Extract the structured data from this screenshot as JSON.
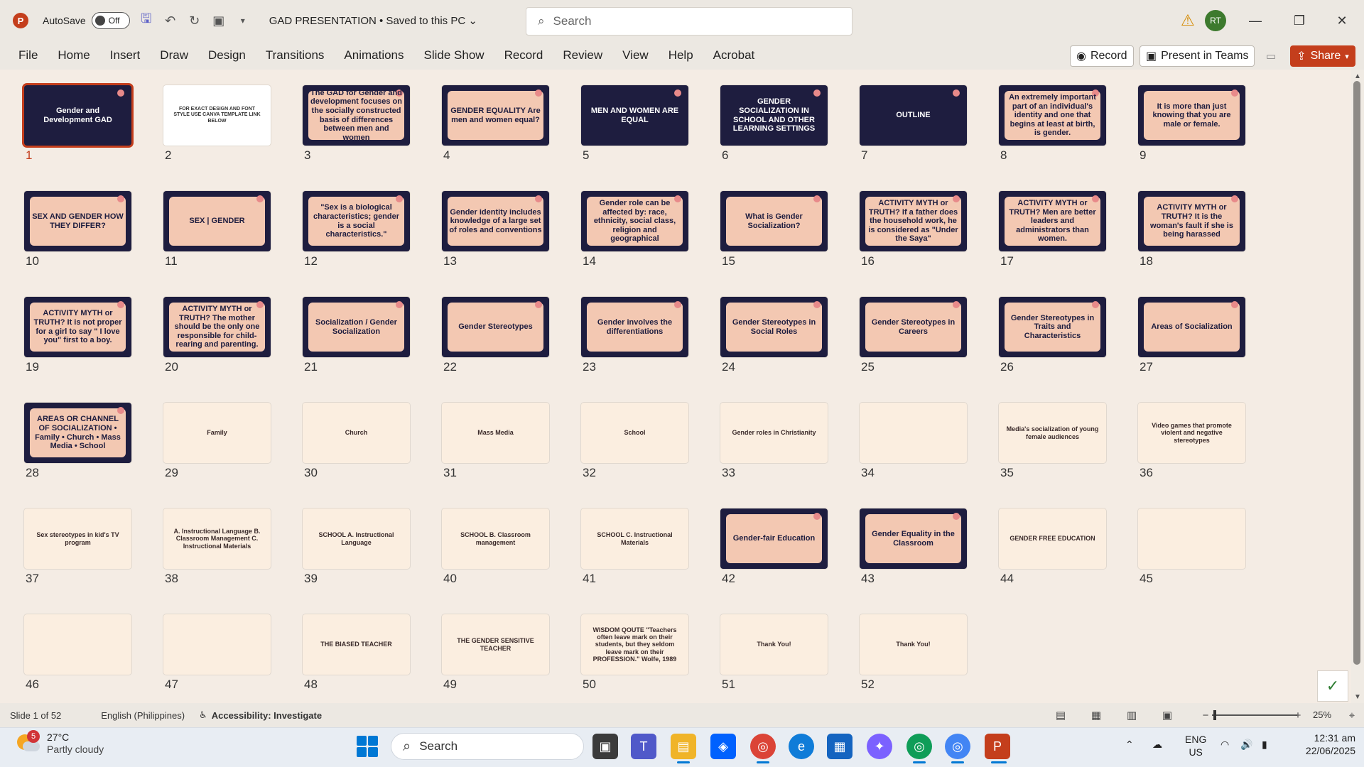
{
  "app": {
    "autosave_label": "AutoSave",
    "autosave_state": "Off",
    "doc_title": "GAD PRESENTATION • Saved to this PC",
    "search_placeholder": "Search",
    "avatar_initials": "RT",
    "accent_color": "#c43e1c"
  },
  "menu": [
    "File",
    "Home",
    "Insert",
    "Draw",
    "Design",
    "Transitions",
    "Animations",
    "Slide Show",
    "Record",
    "Review",
    "View",
    "Help",
    "Acrobat"
  ],
  "ribbon_buttons": {
    "record": "Record",
    "present": "Present in Teams",
    "share": "Share"
  },
  "slides": [
    {
      "num": "1",
      "text": "Gender and Development GAD",
      "style": "navy",
      "selected": true
    },
    {
      "num": "2",
      "text": "FOR EXACT DESIGN AND FONT STYLE USE CANVA TEMPLATE LINK BELOW",
      "style": "white"
    },
    {
      "num": "3",
      "text": "The GAD for Gender and development focuses on the socially constructed basis of differences between men and women",
      "style": "dark"
    },
    {
      "num": "4",
      "text": "GENDER EQUALITY Are men and women equal?",
      "style": "dark"
    },
    {
      "num": "5",
      "text": "MEN AND WOMEN ARE EQUAL",
      "style": "navy"
    },
    {
      "num": "6",
      "text": "GENDER SOCIALIZATION IN SCHOOL AND OTHER LEARNING SETTINGS",
      "style": "navy"
    },
    {
      "num": "7",
      "text": "OUTLINE",
      "style": "navy"
    },
    {
      "num": "8",
      "text": "An extremely important part of an individual's identity and one that begins at least at birth, is gender.",
      "style": "dark"
    },
    {
      "num": "9",
      "text": "It is more than just knowing that you are male or female.",
      "style": "dark"
    },
    {
      "num": "10",
      "text": "SEX AND GENDER HOW THEY DIFFER?",
      "style": "dark"
    },
    {
      "num": "11",
      "text": "SEX | GENDER",
      "style": "dark"
    },
    {
      "num": "12",
      "text": "\"Sex is a biological characteristics; gender is a social characteristics.\"",
      "style": "dark"
    },
    {
      "num": "13",
      "text": "Gender identity includes knowledge of a large set of roles and conventions",
      "style": "dark"
    },
    {
      "num": "14",
      "text": "Gender role can be affected by: race, ethnicity, social class, religion and geographical",
      "style": "dark"
    },
    {
      "num": "15",
      "text": "What is Gender Socialization?",
      "style": "dark"
    },
    {
      "num": "16",
      "text": "ACTIVITY MYTH or TRUTH? If a father does the household work, he is considered as \"Under the Saya\"",
      "style": "dark"
    },
    {
      "num": "17",
      "text": "ACTIVITY MYTH or TRUTH? Men are better leaders and administrators than women.",
      "style": "dark"
    },
    {
      "num": "18",
      "text": "ACTIVITY MYTH or TRUTH? It is the woman's fault if she is being harassed",
      "style": "dark"
    },
    {
      "num": "19",
      "text": "ACTIVITY MYTH or TRUTH? It is not proper for a girl to say \" I love you\" first to a boy.",
      "style": "dark"
    },
    {
      "num": "20",
      "text": "ACTIVITY MYTH or TRUTH? The mother should be the only one responsible for child-rearing and parenting.",
      "style": "dark"
    },
    {
      "num": "21",
      "text": "Socialization / Gender Socialization",
      "style": "dark"
    },
    {
      "num": "22",
      "text": "Gender Stereotypes",
      "style": "dark"
    },
    {
      "num": "23",
      "text": "Gender involves the differentiations",
      "style": "dark"
    },
    {
      "num": "24",
      "text": "Gender Stereotypes in Social Roles",
      "style": "dark"
    },
    {
      "num": "25",
      "text": "Gender Stereotypes in Careers",
      "style": "dark"
    },
    {
      "num": "26",
      "text": "Gender Stereotypes in Traits and Characteristics",
      "style": "dark"
    },
    {
      "num": "27",
      "text": "Areas of Socialization",
      "style": "dark"
    },
    {
      "num": "28",
      "text": "AREAS OR CHANNEL OF SOCIALIZATION • Family • Church • Mass Media • School",
      "style": "dark"
    },
    {
      "num": "29",
      "text": "Family",
      "style": "cream"
    },
    {
      "num": "30",
      "text": "Church",
      "style": "cream"
    },
    {
      "num": "31",
      "text": "Mass Media",
      "style": "cream"
    },
    {
      "num": "32",
      "text": "School",
      "style": "cream"
    },
    {
      "num": "33",
      "text": "Gender roles in Christianity",
      "style": "cream"
    },
    {
      "num": "34",
      "text": "",
      "style": "cream"
    },
    {
      "num": "35",
      "text": "Media's socialization of young female audiences",
      "style": "cream"
    },
    {
      "num": "36",
      "text": "Video games that promote violent and negative stereotypes",
      "style": "cream"
    },
    {
      "num": "37",
      "text": "Sex stereotypes in kid's TV program",
      "style": "cream"
    },
    {
      "num": "38",
      "text": "A. Instructional Language B. Classroom Management C. Instructional Materials",
      "style": "cream"
    },
    {
      "num": "39",
      "text": "SCHOOL A. Instructional Language",
      "style": "cream"
    },
    {
      "num": "40",
      "text": "SCHOOL B. Classroom management",
      "style": "cream"
    },
    {
      "num": "41",
      "text": "SCHOOL C. Instructional Materials",
      "style": "cream"
    },
    {
      "num": "42",
      "text": "Gender-fair Education",
      "style": "dark"
    },
    {
      "num": "43",
      "text": "Gender Equality in the Classroom",
      "style": "dark"
    },
    {
      "num": "44",
      "text": "GENDER FREE EDUCATION",
      "style": "cream"
    },
    {
      "num": "45",
      "text": "",
      "style": "cream"
    },
    {
      "num": "46",
      "text": "",
      "style": "cream"
    },
    {
      "num": "47",
      "text": "",
      "style": "cream"
    },
    {
      "num": "48",
      "text": "THE BIASED TEACHER",
      "style": "cream"
    },
    {
      "num": "49",
      "text": "THE GENDER SENSITIVE TEACHER",
      "style": "cream"
    },
    {
      "num": "50",
      "text": "WISDOM QOUTE \"Teachers often leave mark on their students, but they seldom leave mark on their PROFESSION.\" Wolfe, 1989",
      "style": "cream"
    },
    {
      "num": "51",
      "text": "Thank You!",
      "style": "cream"
    },
    {
      "num": "52",
      "text": "Thank You!",
      "style": "cream"
    }
  ],
  "status": {
    "slide_info": "Slide 1 of 52",
    "language": "English (Philippines)",
    "accessibility": "Accessibility: Investigate",
    "zoom": "25%"
  },
  "taskbar": {
    "weather_temp": "27°C",
    "weather_desc": "Partly cloudy",
    "weather_badge": "5",
    "search_label": "Search",
    "lang1": "ENG",
    "lang2": "US",
    "time": "12:31 am",
    "date": "22/06/2025"
  }
}
